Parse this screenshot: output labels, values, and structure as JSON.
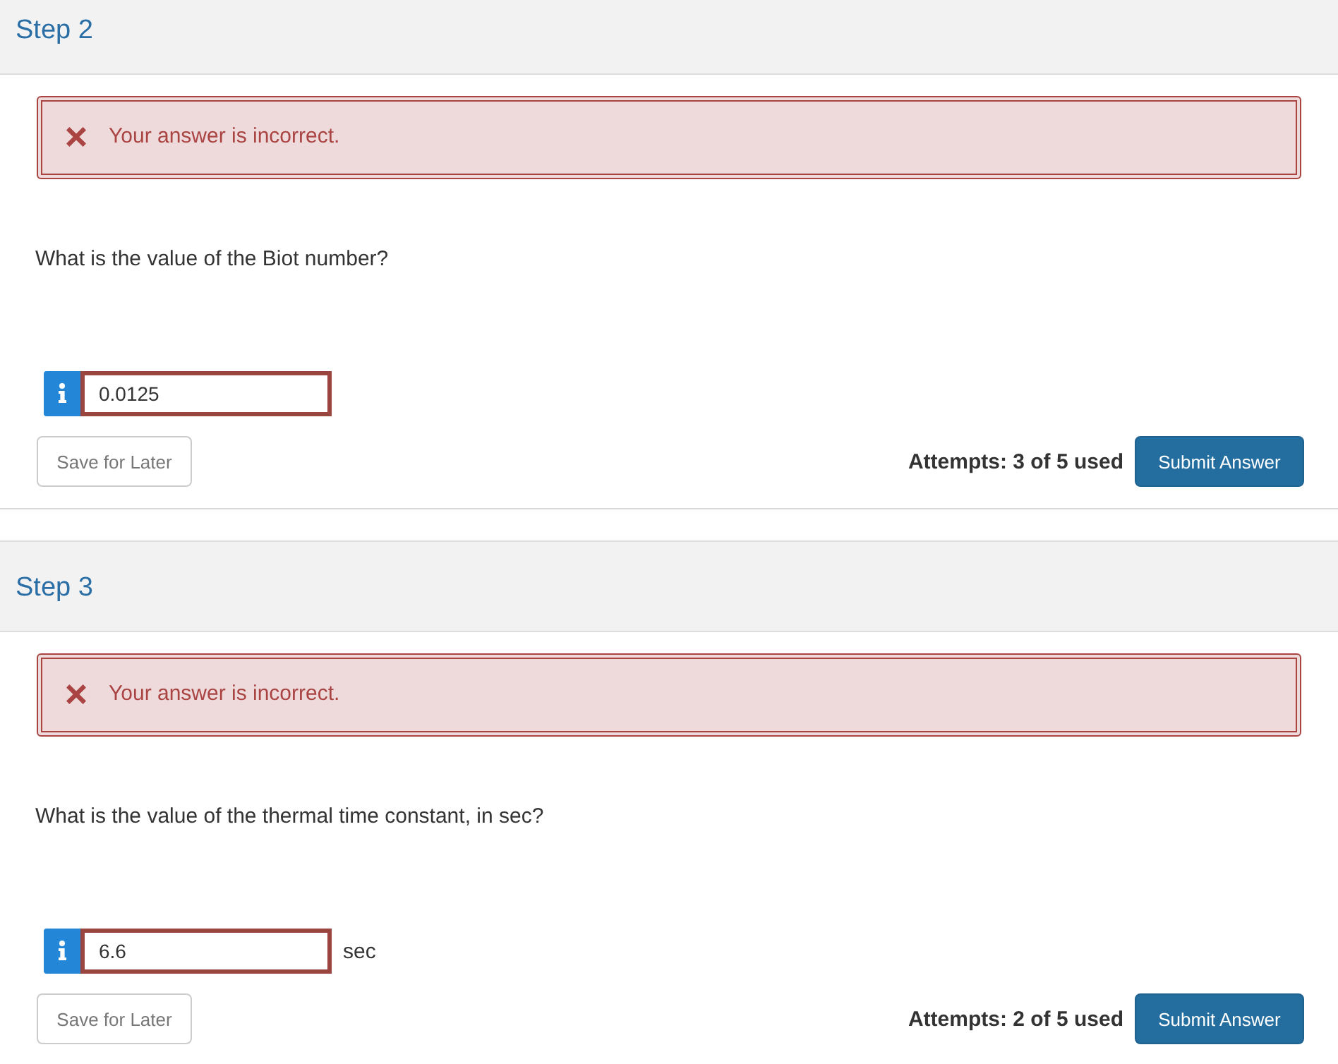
{
  "steps": [
    {
      "title": "Step 2",
      "feedback": {
        "kind": "incorrect",
        "message": "Your answer is incorrect."
      },
      "question": "What is the value of the Biot number?",
      "answer": {
        "value": "0.0125",
        "incorrect": true
      },
      "save_button": "Save for Later",
      "attempts": "Attempts: 3 of 5 used",
      "submit_button": "Submit Answer"
    },
    {
      "title": "Step 3",
      "feedback": {
        "kind": "incorrect",
        "message": "Your answer is incorrect."
      },
      "question": "What is the value of the thermal time constant, in sec?",
      "answer": {
        "value": "6.6",
        "incorrect": true,
        "unit": "sec"
      },
      "save_button": "Save for Later",
      "attempts": "Attempts: 2 of 5 used",
      "submit_button": "Submit Answer"
    }
  ]
}
